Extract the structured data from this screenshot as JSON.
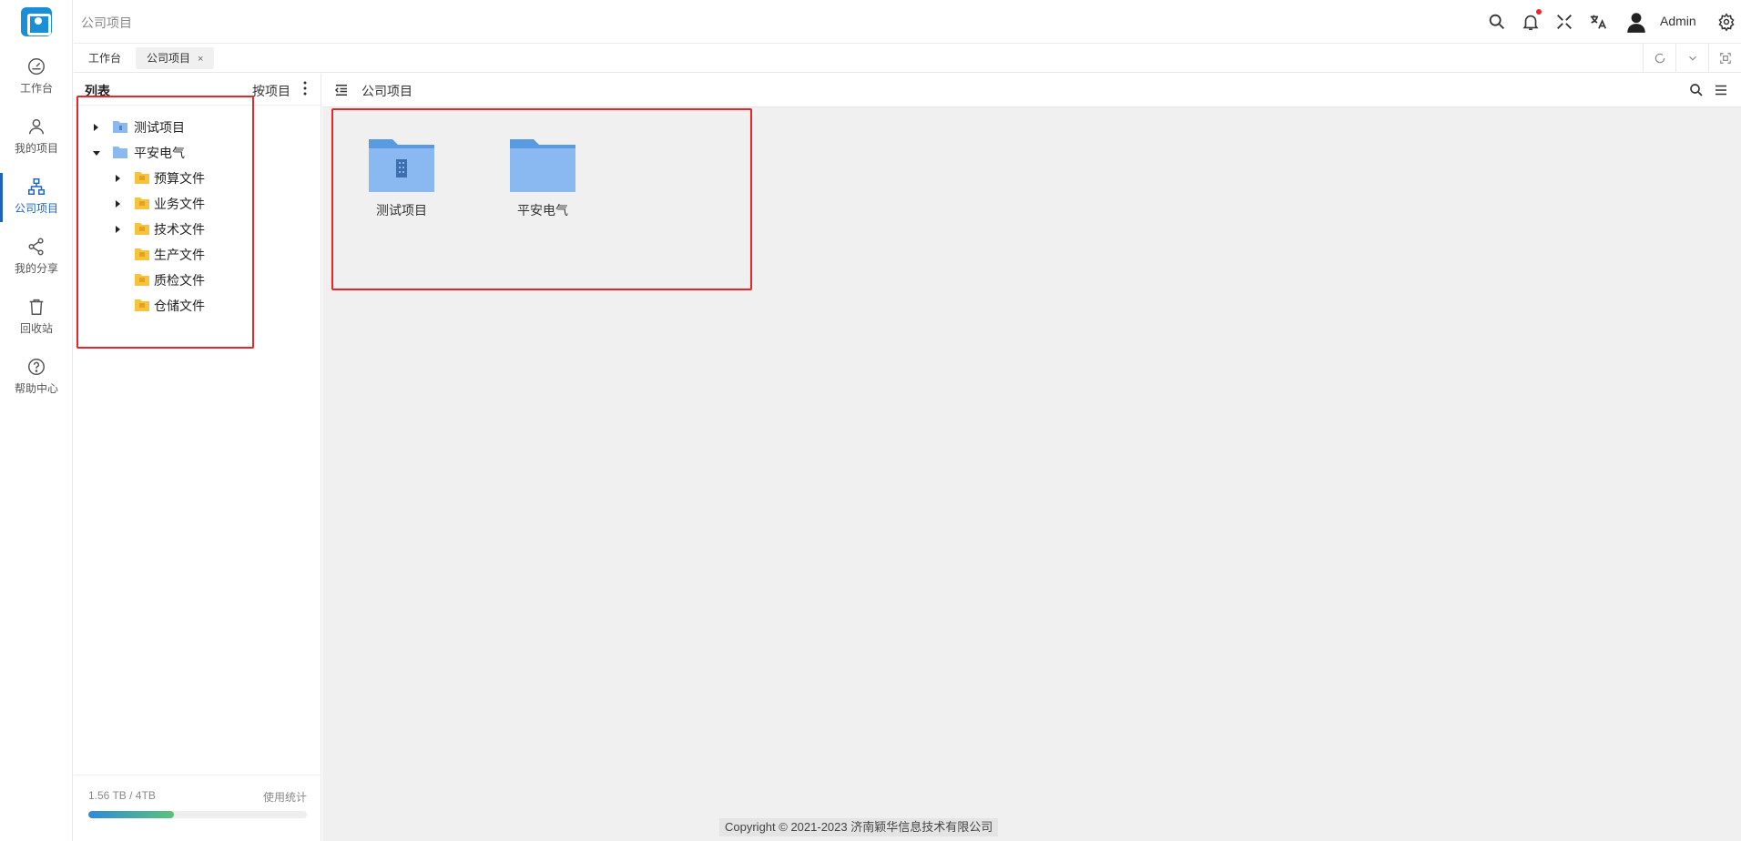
{
  "header": {
    "breadcrumb": "公司项目",
    "username": "Admin",
    "icons": [
      "search-icon",
      "bell-icon",
      "fullscreen-icon",
      "translate-icon",
      "avatar",
      "settings-icon"
    ]
  },
  "nav": {
    "items": [
      {
        "label": "工作台",
        "icon": "dashboard-icon"
      },
      {
        "label": "我的项目",
        "icon": "user-icon"
      },
      {
        "label": "公司项目",
        "icon": "org-tree-icon",
        "active": true
      },
      {
        "label": "我的分享",
        "icon": "share-icon"
      },
      {
        "label": "回收站",
        "icon": "trash-icon"
      },
      {
        "label": "帮助中心",
        "icon": "help-icon"
      }
    ]
  },
  "tabs": [
    {
      "label": "工作台"
    },
    {
      "label": "公司项目",
      "active": true,
      "close": "×"
    }
  ],
  "panel": {
    "title": "列表",
    "mode": "按项目",
    "tree": [
      {
        "label": "测试项目"
      },
      {
        "label": "平安电气"
      },
      {
        "label": "预算文件"
      },
      {
        "label": "业务文件"
      },
      {
        "label": "技术文件"
      },
      {
        "label": "生产文件"
      },
      {
        "label": "质检文件"
      },
      {
        "label": "仓储文件"
      }
    ],
    "usage": {
      "amount": "1.56 TB / 4TB",
      "link": "使用统计",
      "fraction": 0.39
    }
  },
  "content": {
    "title": "公司项目",
    "folders": [
      {
        "label": "测试项目"
      },
      {
        "label": "平安电气"
      }
    ]
  },
  "footer": {
    "copyright": "Copyright © 2021-2023 济南颖华信息技术有限公司"
  },
  "colors": {
    "accent": "#1f64b8",
    "highlight": "#e8262a",
    "folder_blue": "#8ab8f0",
    "folder_yellow": "#f7c23c"
  }
}
